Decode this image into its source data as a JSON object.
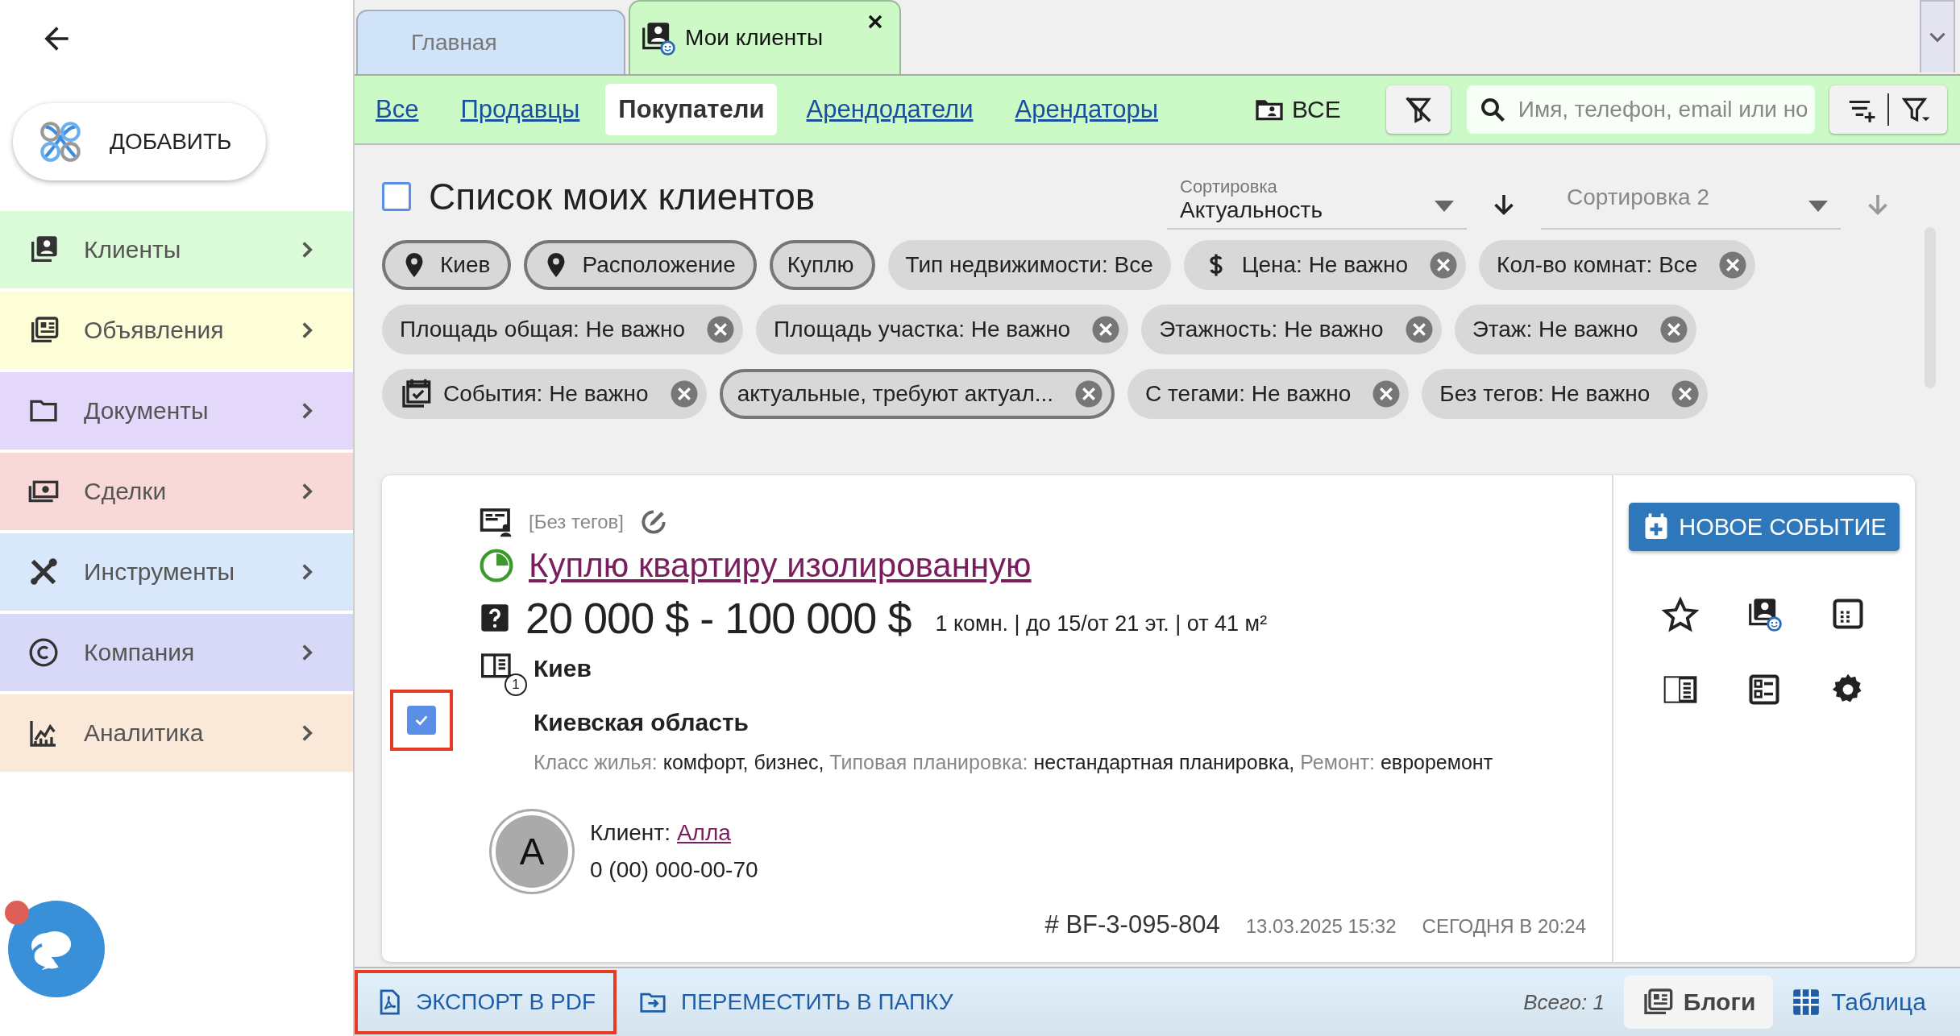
{
  "sidebar": {
    "add_button": "ДОБАВИТЬ",
    "items": [
      {
        "label": "Клиенты",
        "color": "#dafad8"
      },
      {
        "label": "Объявления",
        "color": "#fdfdd8"
      },
      {
        "label": "Документы",
        "color": "#e4d8fa"
      },
      {
        "label": "Сделки",
        "color": "#f9d8d8"
      },
      {
        "label": "Инструменты",
        "color": "#d8e8fa"
      },
      {
        "label": "Компания",
        "color": "#d8d8f8"
      },
      {
        "label": "Аналитика",
        "color": "#fae8d8"
      }
    ],
    "chat": {
      "unread": true
    }
  },
  "tabs": [
    {
      "label": "Главная",
      "selected": false
    },
    {
      "label": "Мои клиенты",
      "selected": true
    }
  ],
  "filters": [
    {
      "label": "Все",
      "selected": false
    },
    {
      "label": "Продавцы",
      "selected": false
    },
    {
      "label": "Покупатели",
      "selected": true
    },
    {
      "label": "Арендодатели",
      "selected": false
    },
    {
      "label": "Арендаторы",
      "selected": false
    }
  ],
  "folder_button": "ВСЕ",
  "search": {
    "placeholder": "Имя, телефон, email или но"
  },
  "list": {
    "title": "Список моих клиентов",
    "select_all": {
      "checked": false
    },
    "sort1": {
      "label": "Сортировка",
      "value": "Актуальность"
    },
    "sort2": {
      "placeholder": "Сортировка 2"
    },
    "chips": [
      {
        "label": "Киев",
        "kind": "location",
        "outlined": true,
        "removable": false
      },
      {
        "label": "Расположение",
        "kind": "location",
        "outlined": true,
        "removable": false
      },
      {
        "label": "Куплю",
        "kind": "plain",
        "outlined": true,
        "removable": false
      },
      {
        "label": "Тип недвижимости: Все",
        "kind": "plain",
        "outlined": false,
        "removable": false
      },
      {
        "label": "Цена: Не важно",
        "kind": "price",
        "outlined": false,
        "removable": true
      },
      {
        "label": "Кол-во комнат: Все",
        "kind": "plain",
        "outlined": false,
        "removable": true
      },
      {
        "label": "Площадь общая: Не важно",
        "kind": "plain",
        "outlined": false,
        "removable": true
      },
      {
        "label": "Площадь участка: Не важно",
        "kind": "plain",
        "outlined": false,
        "removable": true
      },
      {
        "label": "Этажность: Не важно",
        "kind": "plain",
        "outlined": false,
        "removable": true
      },
      {
        "label": "Этаж: Не важно",
        "kind": "plain",
        "outlined": false,
        "removable": true
      },
      {
        "label": "События: Не важно",
        "kind": "events",
        "outlined": false,
        "removable": true
      },
      {
        "label": "актуальные, требуют актуал...",
        "kind": "plain",
        "outlined": true,
        "removable": true
      },
      {
        "label": "С тегами: Не важно",
        "kind": "plain",
        "outlined": false,
        "removable": true
      },
      {
        "label": "Без тегов: Не важно",
        "kind": "plain",
        "outlined": false,
        "removable": true
      }
    ]
  },
  "card": {
    "checked": true,
    "highlighted": true,
    "tags": "[Без тегов]",
    "title": "Куплю квартиру изолированную",
    "price": "20 000 $ - 100 000 $",
    "details": "1 комн. | до 15/от 21 эт. | от 41 м²",
    "address_count": "1",
    "city": "Киев",
    "region": "Киевская область",
    "attributes": [
      {
        "label": "Класс жилья:",
        "value": "комфорт, бизнес,"
      },
      {
        "label": "Типовая планировка:",
        "value": "нестандартная планировка,"
      },
      {
        "label": "Ремонт:",
        "value": "евроремонт"
      }
    ],
    "client": {
      "avatar": "А",
      "label": "Клиент:",
      "name": "Алла",
      "phone": "0 (00) 000-00-70"
    },
    "code": "# BF-3-095-804",
    "created": "13.03.2025 15:32",
    "updated": "СЕГОДНЯ В 20:24",
    "new_event_button": "НОВОЕ СОБЫТИЕ"
  },
  "bottom_bar": {
    "actions": [
      {
        "label": "ЭКСПОРТ В PDF",
        "highlighted": true
      },
      {
        "label": "ПЕРЕМЕСТИТЬ В ПАПКУ",
        "highlighted": false
      }
    ],
    "total": "Всего: 1",
    "views": [
      {
        "label": "Блоги",
        "selected": true
      },
      {
        "label": "Таблица",
        "selected": false
      }
    ]
  }
}
